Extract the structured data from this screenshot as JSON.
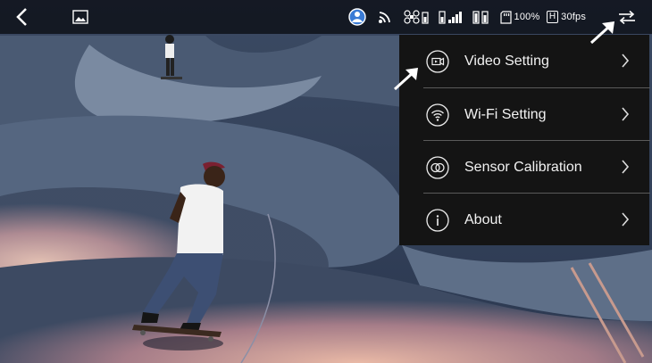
{
  "status_bar": {
    "battery_percent": "100%",
    "resolution_badge": "H",
    "frame_rate": "30fps",
    "icons": [
      "back-icon",
      "gallery-icon",
      "tracking-icon",
      "wifi-signal-icon",
      "drone-signal-icon",
      "remote-battery-icon",
      "gimbal-battery-icon",
      "sd-card-icon",
      "settings-icon"
    ]
  },
  "settings_menu": {
    "items": [
      {
        "label": "Video Setting",
        "icon": "video-icon"
      },
      {
        "label": "Wi-Fi Setting",
        "icon": "wifi-icon"
      },
      {
        "label": "Sensor Calibration",
        "icon": "calibration-icon"
      },
      {
        "label": "About",
        "icon": "info-icon"
      }
    ]
  },
  "colors": {
    "menu_background": "#141414",
    "menu_text": "#f2f2f2"
  }
}
